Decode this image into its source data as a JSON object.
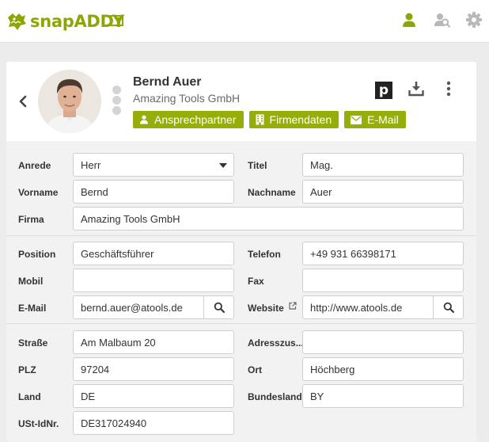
{
  "app": {
    "name": "snapADDY"
  },
  "contact": {
    "name": "Bernd Auer",
    "company": "Amazing Tools GmbH"
  },
  "actions": {
    "contact_label": "Ansprechpartner",
    "company_label": "Firmendaten",
    "email_label": "E-Mail"
  },
  "pipedrive_letter": "p",
  "colors": {
    "accent": "#97ad0a",
    "brand": "#8ea604"
  },
  "form": {
    "salutation": {
      "label": "Anrede",
      "value": "Herr"
    },
    "title": {
      "label": "Titel",
      "value": "Mag."
    },
    "first_name": {
      "label": "Vorname",
      "value": "Bernd"
    },
    "last_name": {
      "label": "Nachname",
      "value": "Auer"
    },
    "company": {
      "label": "Firma",
      "value": "Amazing Tools GmbH"
    },
    "position": {
      "label": "Position",
      "value": "Geschäftsführer"
    },
    "phone": {
      "label": "Telefon",
      "value": "+49 931 66398171"
    },
    "mobile": {
      "label": "Mobil",
      "value": ""
    },
    "fax": {
      "label": "Fax",
      "value": ""
    },
    "email": {
      "label": "E-Mail",
      "value": "bernd.auer@atools.de"
    },
    "website": {
      "label": "Website",
      "value": "http://www.atools.de"
    },
    "street": {
      "label": "Straße",
      "value": "Am Malbaum 20"
    },
    "address_extra": {
      "label": "Adresszus...",
      "value": ""
    },
    "zip": {
      "label": "PLZ",
      "value": "97204"
    },
    "city": {
      "label": "Ort",
      "value": "Höchberg"
    },
    "country": {
      "label": "Land",
      "value": "DE"
    },
    "state": {
      "label": "Bundesland",
      "value": "BY"
    },
    "vat_id": {
      "label": "USt-IdNr.",
      "value": "DE317024940"
    }
  }
}
